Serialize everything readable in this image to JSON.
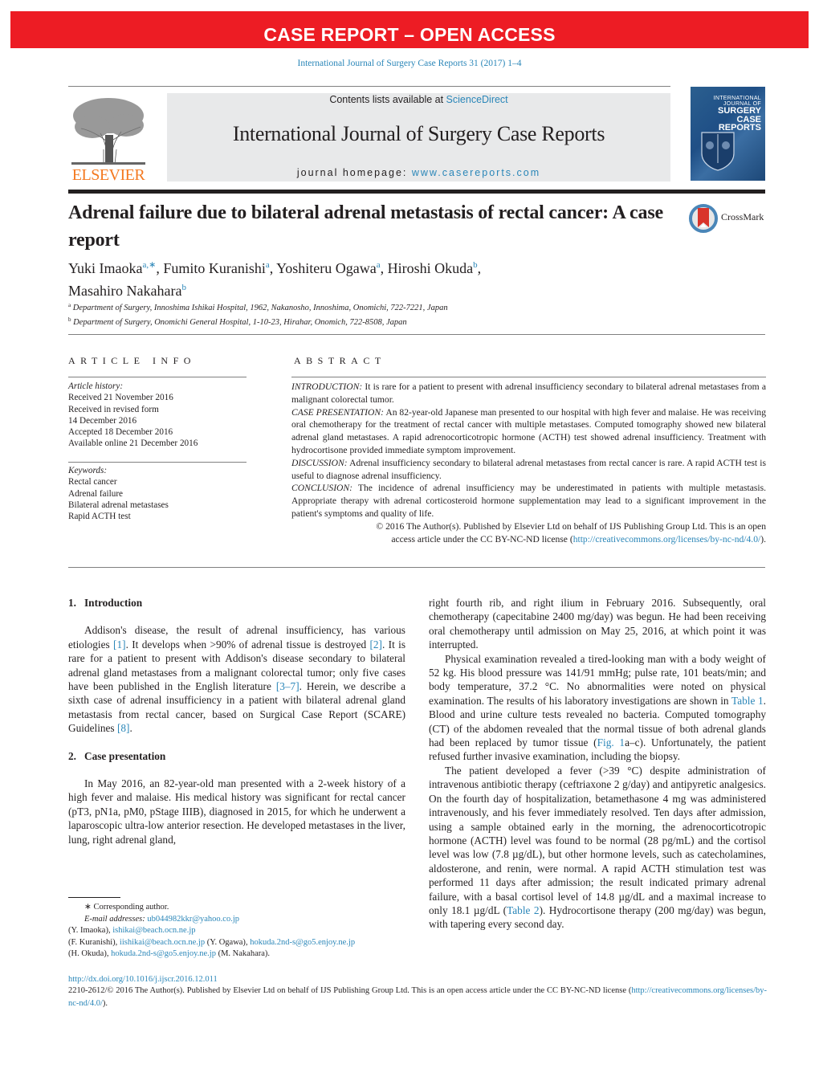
{
  "banner": {
    "text": "CASE REPORT – OPEN ACCESS",
    "color": "#ed1c24"
  },
  "citation": "International Journal of Surgery Case Reports 31 (2017) 1–4",
  "masthead": {
    "publisher_logo_text": "ELSEVIER",
    "contents_prefix": "Contents lists available at ",
    "contents_link": "ScienceDirect",
    "journal_title": "International Journal of Surgery Case Reports",
    "homepage_prefix": "journal homepage: ",
    "homepage_link": "www.casereports.com",
    "cover": {
      "line1": "INTERNATIONAL",
      "line2": "JOURNAL OF",
      "line3": "SURGERY",
      "line4": "CASE",
      "line5": "REPORTS"
    }
  },
  "article": {
    "title": "Adrenal failure due to bilateral adrenal metastasis of rectal cancer: A case report",
    "crossmark_label": "CrossMark",
    "authors": [
      {
        "name": "Yuki Imaoka",
        "sup": "a,∗",
        "sep": ", "
      },
      {
        "name": "Fumito Kuranishi",
        "sup": "a",
        "sep": ", "
      },
      {
        "name": "Yoshiteru Ogawa",
        "sup": "a",
        "sep": ", "
      },
      {
        "name": "Hiroshi Okuda",
        "sup": "b",
        "sep": ","
      },
      {
        "name": "Masahiro Nakahara",
        "sup": "b",
        "sep": ""
      }
    ],
    "affiliations": [
      {
        "sup": "a",
        "text": "Department of Surgery, Innoshima Ishikai Hospital, 1962, Nakanosho, Innoshima, Onomichi, 722-7221, Japan"
      },
      {
        "sup": "b",
        "text": "Department of Surgery, Onomichi General Hospital, 1-10-23, Hirahar, Onomich, 722-8508, Japan"
      }
    ]
  },
  "article_info": {
    "heading": "ARTICLE INFO",
    "history_label": "Article history:",
    "history": [
      "Received 21 November 2016",
      "Received in revised form",
      "14 December 2016",
      "Accepted 18 December 2016",
      "Available online 21 December 2016"
    ],
    "keywords_label": "Keywords:",
    "keywords": [
      "Rectal cancer",
      "Adrenal failure",
      "Bilateral adrenal metastases",
      "Rapid ACTH test"
    ]
  },
  "abstract": {
    "heading": "ABSTRACT",
    "sections": [
      {
        "label": "INTRODUCTION:",
        "text": " It is rare for a patient to present with adrenal insufficiency secondary to bilateral adrenal metastases from a malignant colorectal tumor."
      },
      {
        "label": "CASE PRESENTATION:",
        "text": " An 82-year-old Japanese man presented to our hospital with high fever and malaise. He was receiving oral chemotherapy for the treatment of rectal cancer with multiple metastases. Computed tomography showed new bilateral adrenal gland metastases. A rapid adrenocorticotropic hormone (ACTH) test showed adrenal insufficiency. Treatment with hydrocortisone provided immediate symptom improvement."
      },
      {
        "label": "DISCUSSION:",
        "text": " Adrenal insufficiency secondary to bilateral adrenal metastases from rectal cancer is rare. A rapid ACTH test is useful to diagnose adrenal insufficiency."
      },
      {
        "label": "CONCLUSION:",
        "text": " The incidence of adrenal insufficiency may be underestimated in patients with multiple metastasis. Appropriate therapy with adrenal corticosteroid hormone supplementation may lead to a significant improvement in the patient's symptoms and quality of life."
      }
    ],
    "copyright_line1": "© 2016 The Author(s). Published by Elsevier Ltd on behalf of IJS Publishing Group Ltd. This is an open",
    "copyright_line2_prefix": "access article under the CC BY-NC-ND license (",
    "copyright_link": "http://creativecommons.org/licenses/by-nc-nd/4.0/",
    "copyright_line2_suffix": ")."
  },
  "body": {
    "intro": {
      "number": "1.",
      "title": "Introduction",
      "p1": [
        {
          "t": "Addison's disease, the result of adrenal insufficiency, has various etiologies "
        },
        {
          "link": "[1]"
        },
        {
          "t": ". It develops when >90% of adrenal tissue is destroyed "
        },
        {
          "link": "[2]"
        },
        {
          "t": ". It is rare for a patient to present with Addison's disease secondary to bilateral adrenal gland metastases from a malignant colorectal tumor; only five cases have been published in the English literature "
        },
        {
          "link": "[3–7]"
        },
        {
          "t": ". Herein, we describe a sixth case of adrenal insufficiency in a patient with bilateral adrenal gland metastasis from rectal cancer, based on Surgical Case Report (SCARE) Guidelines "
        },
        {
          "link": "[8]"
        },
        {
          "t": "."
        }
      ]
    },
    "case": {
      "number": "2.",
      "title": "Case presentation",
      "p1_left": "In May 2016, an 82-year-old man presented with a 2-week history of a high fever and malaise. His medical history was significant for rectal cancer (pT3, pN1a, pM0, pStage IIIB), diagnosed in 2015, for which he underwent a laparoscopic ultra-low anterior resection. He developed metastases in the liver, lung, right adrenal gland,",
      "p1_right": "right fourth rib, and right ilium in February 2016. Subsequently, oral chemotherapy (capecitabine 2400 mg/day) was begun. He had been receiving oral chemotherapy until admission on May 25, 2016, at which point it was interrupted.",
      "p2": [
        {
          "t": "Physical examination revealed a tired-looking man with a body weight of 52 kg. His blood pressure was 141/91 mmHg; pulse rate, 101 beats/min; and body temperature, 37.2 °C. No abnormalities were noted on physical examination. The results of his laboratory investigations are shown in "
        },
        {
          "link": "Table 1"
        },
        {
          "t": ". Blood and urine culture tests revealed no bacteria. Computed tomography (CT) of the abdomen revealed that the normal tissue of both adrenal glands had been replaced by tumor tissue ("
        },
        {
          "link": "Fig. 1"
        },
        {
          "t": "a–c). Unfortunately, the patient refused further invasive examination, including the biopsy."
        }
      ],
      "p3": [
        {
          "t": "The patient developed a fever (>39 °C) despite administration of intravenous antibiotic therapy (ceftriaxone 2 g/day) and antipyretic analgesics. On the fourth day of hospitalization, betamethasone 4 mg was administered intravenously, and his fever immediately resolved. Ten days after admission, using a sample obtained early in the morning, the adrenocorticotropic hormone (ACTH) level was found to be normal (28 pg/mL) and the cortisol level was low (7.8 µg/dL), but other hormone levels, such as catecholamines, aldosterone, and renin, were normal. A rapid ACTH stimulation test was performed 11 days after admission; the result indicated primary adrenal failure, with a basal cortisol level of 14.8 µg/dL and a maximal increase to only 18.1 µg/dL ("
        },
        {
          "link": "Table 2"
        },
        {
          "t": "). Hydrocortisone therapy (200 mg/day) was begun, with tapering every second day."
        }
      ]
    }
  },
  "footnotes": {
    "corresponding_mark": "∗",
    "corresponding_text": "Corresponding author.",
    "email_label": "E-mail addresses:",
    "emails": [
      {
        "email": "ub044982kkr@yahoo.co.jp",
        "name": "(Y. Imaoka)"
      },
      {
        "email": "ishikai@beach.ocn.ne.jp",
        "name": "(F. Kuranishi)"
      },
      {
        "email": "iishikai@beach.ocn.ne.jp",
        "name": "(Y. Ogawa)"
      },
      {
        "email": "hokuda.2nd-s@go5.enjoy.ne.jp",
        "name": "(H. Okuda)"
      },
      {
        "email": "hokuda.2nd-s@go5.enjoy.ne.jp",
        "name": "(M. Nakahara)."
      }
    ]
  },
  "bottom": {
    "doi": "http://dx.doi.org/10.1016/j.ijscr.2016.12.011",
    "license_text": "2210-2612/© 2016 The Author(s). Published by Elsevier Ltd on behalf of IJS Publishing Group Ltd. This is an open access article under the CC BY-NC-ND license (",
    "license_link": "http://creativecommons.org/licenses/by-nc-nd/4.0/",
    "license_suffix": ")."
  }
}
